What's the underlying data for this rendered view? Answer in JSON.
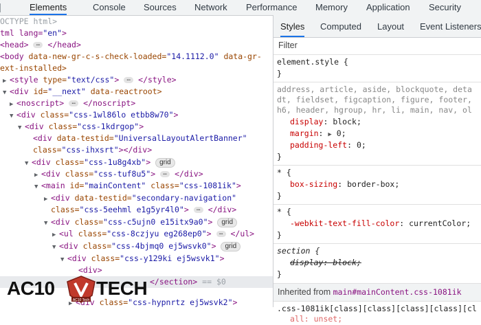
{
  "toolbar": {
    "tabs": [
      "Elements",
      "Console",
      "Sources",
      "Network",
      "Performance",
      "Memory",
      "Application",
      "Security"
    ],
    "active": "Elements"
  },
  "dom": {
    "l0": "OCTYPE html>",
    "l1_tag": "tml lang=",
    "l1_val": "\"en\"",
    "l2_open": "<head>",
    "l2_close": "</head>",
    "l3_tag": "<body",
    "l3_attr": " data-new-gr-c-s-check-loaded=",
    "l3_val": "\"14.1112.0\"",
    "l3_attr2": " data-gr-",
    "l4": "ext-installed>",
    "l5_tag": "<style",
    "l5_attr": " type=",
    "l5_val": "\"text/css\"",
    "l5_close": "</style>",
    "l6_tag": "<div",
    "l6_attr": " id=",
    "l6_val": "\"__next\"",
    "l6_attr2": " data-reactroot>",
    "l7_open": "<noscript>",
    "l7_close": "</noscript>",
    "l8_val": "\"css-1wl86lo etbb8w70\"",
    "l9_val": "\"css-1kdrgop\"",
    "l10_attr": " data-testid=",
    "l10_val": "\"UniversalLayoutAlertBanner\"",
    "l11_val": "\"css-ihxsrt\"",
    "l12_val": "\"css-1u8g4xb\"",
    "grid_badge": "grid",
    "l13_val": "\"css-tuf8u5\"",
    "l14_attr": " id=",
    "l14_val": "\"mainContent\"",
    "l14_val2": "\"css-1081ik\"",
    "l15_val": "\"secondary-navigation\"",
    "l16_val": "\"css-5eehml e1g5yr4l0\"",
    "l17_val": "\"css-c5ujn0 e15itx9a0\"",
    "l18_val": "\"css-8czjyu eg268ep0\"",
    "l19_val": "\"css-4bjmq0 ej5wsvk0\"",
    "l20_val": "\"css-y129ki ej5wsvk1\"",
    "l21": "<div>",
    "l22_close": "</section>",
    "l22_eq": " == $0",
    "l23_val": "\"css-hypnrtz ej5wsvk2\"",
    "class_attr": " class=",
    "div_open": "<div",
    "main_open": "<main",
    "ul_open": "<ul",
    "div_close": "</div>",
    "main_close": "</main>",
    "ul_close": "</ul>",
    "gt": ">",
    "ell": "…"
  },
  "styles_panel": {
    "subtabs": [
      "Styles",
      "Computed",
      "Layout",
      "Event Listeners"
    ],
    "active": "Styles",
    "filter_placeholder": "Filter",
    "rule1_selector": "element.style {",
    "close_brace": "}",
    "rule2_sel_1": "address, article, aside, blockquote, deta",
    "rule2_sel_2": "dt, fieldset, figcaption, figure, footer,",
    "rule2_sel_3": "h6, header, hgroup, hr, li, main, nav, ol",
    "rule2_p1": "display",
    "rule2_v1": "block;",
    "rule2_p2": "margin",
    "rule2_v2": "0;",
    "rule2_p3": "padding-left",
    "rule2_v3": "0;",
    "rule3_sel": "* {",
    "rule3_p": "box-sizing",
    "rule3_v": "border-box;",
    "rule4_sel": "* {",
    "rule4_p": "-webkit-text-fill-color",
    "rule4_v": "currentColor;",
    "rule5_sel": "section {",
    "rule5_decl": "display: block;",
    "inherited_label": "Inherited from",
    "inherited_el": "main",
    "inherited_sel": "#mainContent.css-1081ik",
    "rule6_sel": ".css-1081ik[class][class][class][class][cl",
    "rule6_decl": "all: unset;"
  },
  "watermark": {
    "left": "AC10",
    "right": "TECH",
    "tagline": "AC10 Tech"
  }
}
